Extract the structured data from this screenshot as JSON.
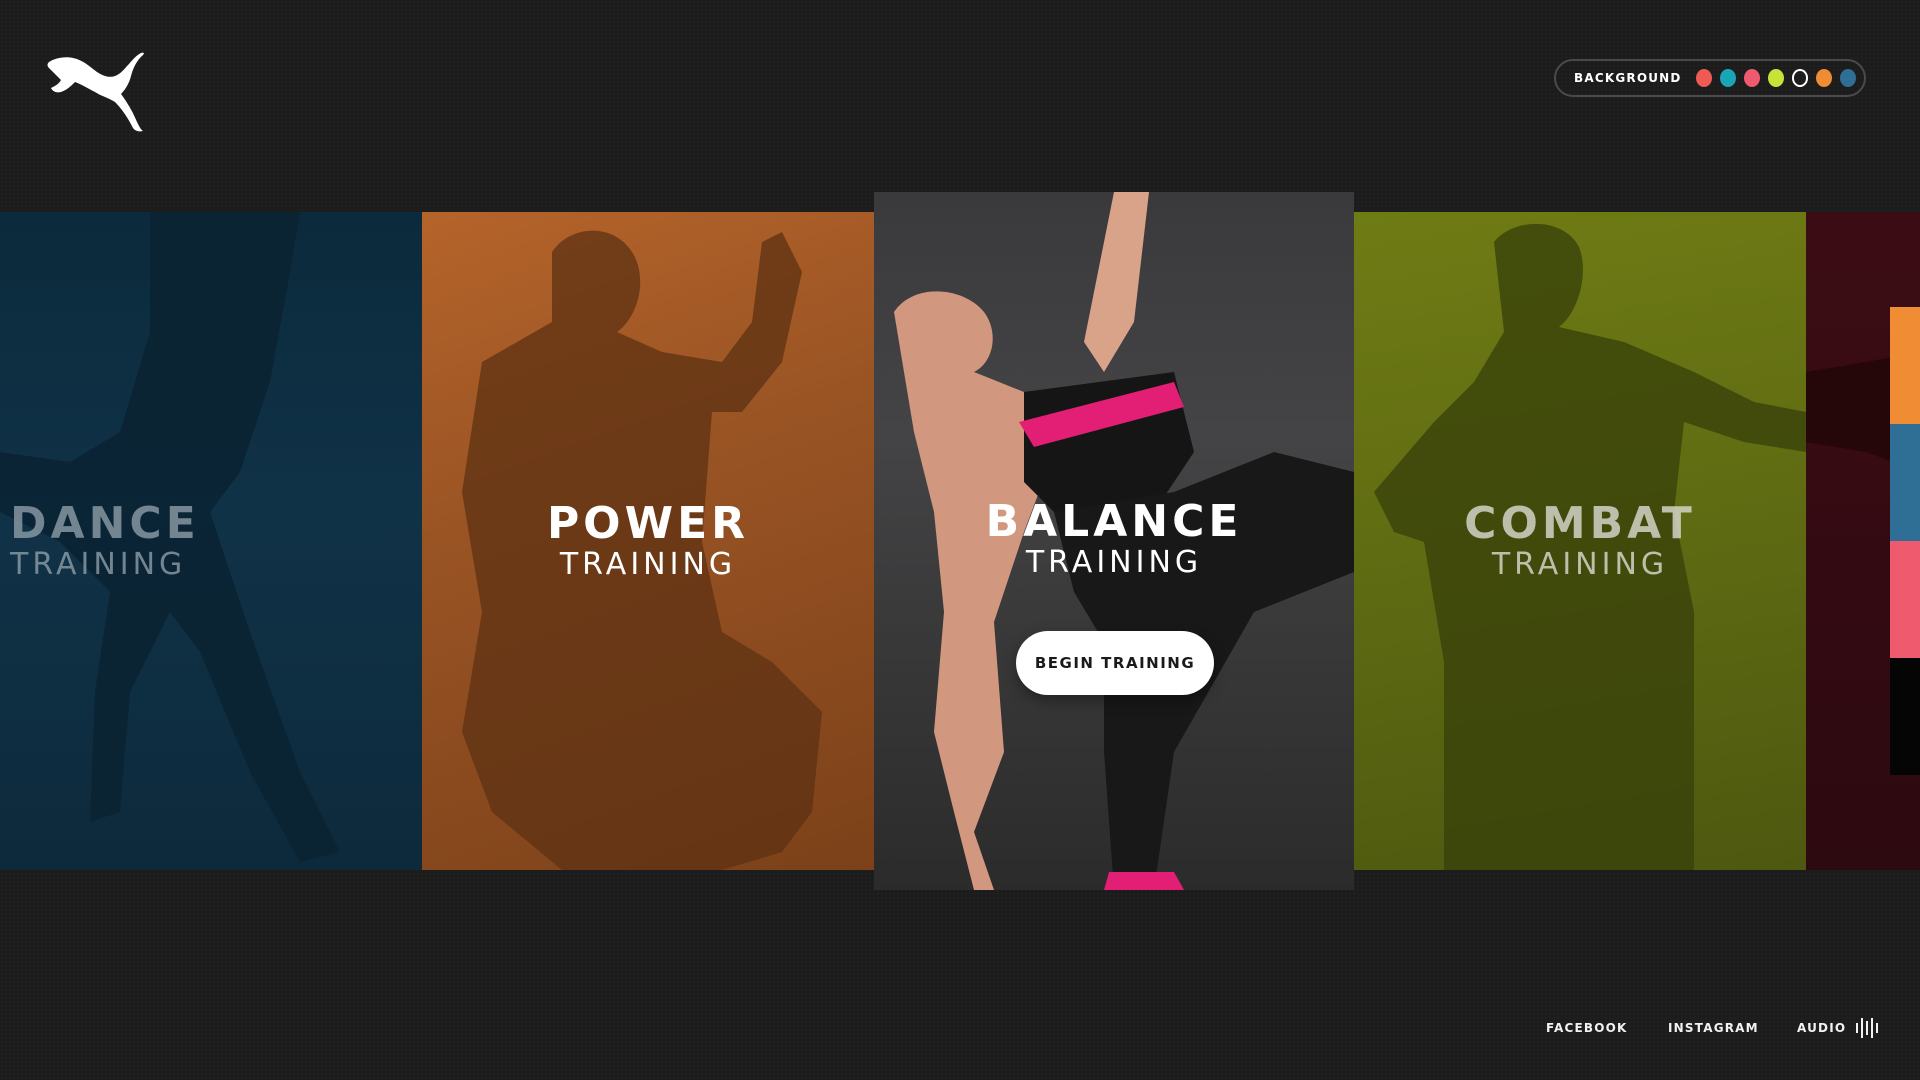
{
  "brand": {
    "logo_icon": "puma-cat-logo-icon"
  },
  "background_picker": {
    "label": "BACKGROUND",
    "swatches": [
      {
        "name": "coral",
        "color": "#ef5b52"
      },
      {
        "name": "teal",
        "color": "#1aa5b4"
      },
      {
        "name": "pink",
        "color": "#ef5a6e"
      },
      {
        "name": "lime",
        "color": "#c9e23a"
      },
      {
        "name": "dark",
        "color": "outline"
      },
      {
        "name": "orange",
        "color": "#f08c33"
      },
      {
        "name": "blue",
        "color": "#2f6f95"
      }
    ]
  },
  "cards": [
    {
      "id": "dance",
      "title": "DANCE",
      "subtitle": "TRAINING",
      "tint": "#103247"
    },
    {
      "id": "power",
      "title": "POWER",
      "subtitle": "TRAINING",
      "tint": "#9a5424"
    },
    {
      "id": "balance",
      "title": "BALANCE",
      "subtitle": "TRAINING",
      "tint": "#3d3d3f",
      "cta": "BEGIN TRAINING"
    },
    {
      "id": "combat",
      "title": "COMBAT",
      "subtitle": "TRAINING",
      "tint": "#5f6b12"
    },
    {
      "id": "next",
      "title": "",
      "subtitle": "",
      "tint": "#3c0c14"
    }
  ],
  "edge_strip": [
    "#f08c33",
    "#2f6f95",
    "#ef5a6e",
    "#050505"
  ],
  "footer": {
    "facebook": "FACEBOOK",
    "instagram": "INSTAGRAM",
    "audio": "AUDIO",
    "audio_icon": "audio-bars-icon"
  }
}
